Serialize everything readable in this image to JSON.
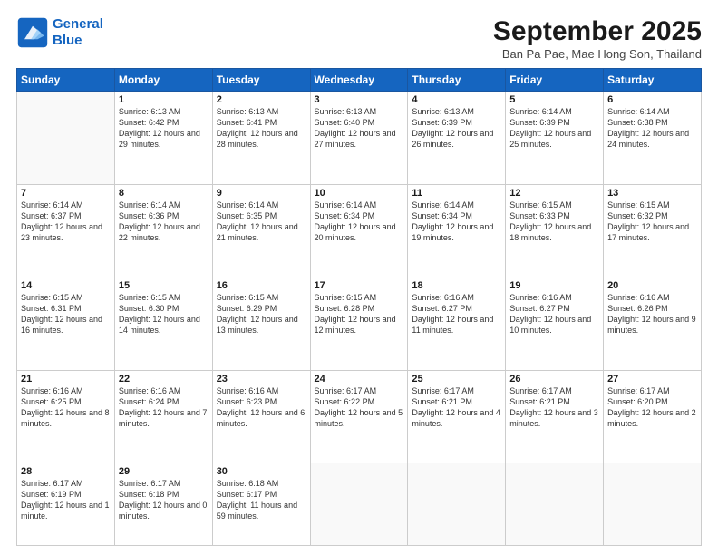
{
  "logo": {
    "line1": "General",
    "line2": "Blue"
  },
  "title": "September 2025",
  "subtitle": "Ban Pa Pae, Mae Hong Son, Thailand",
  "weekdays": [
    "Sunday",
    "Monday",
    "Tuesday",
    "Wednesday",
    "Thursday",
    "Friday",
    "Saturday"
  ],
  "weeks": [
    [
      {
        "day": "",
        "sunrise": "",
        "sunset": "",
        "daylight": ""
      },
      {
        "day": "1",
        "sunrise": "Sunrise: 6:13 AM",
        "sunset": "Sunset: 6:42 PM",
        "daylight": "Daylight: 12 hours and 29 minutes."
      },
      {
        "day": "2",
        "sunrise": "Sunrise: 6:13 AM",
        "sunset": "Sunset: 6:41 PM",
        "daylight": "Daylight: 12 hours and 28 minutes."
      },
      {
        "day": "3",
        "sunrise": "Sunrise: 6:13 AM",
        "sunset": "Sunset: 6:40 PM",
        "daylight": "Daylight: 12 hours and 27 minutes."
      },
      {
        "day": "4",
        "sunrise": "Sunrise: 6:13 AM",
        "sunset": "Sunset: 6:39 PM",
        "daylight": "Daylight: 12 hours and 26 minutes."
      },
      {
        "day": "5",
        "sunrise": "Sunrise: 6:14 AM",
        "sunset": "Sunset: 6:39 PM",
        "daylight": "Daylight: 12 hours and 25 minutes."
      },
      {
        "day": "6",
        "sunrise": "Sunrise: 6:14 AM",
        "sunset": "Sunset: 6:38 PM",
        "daylight": "Daylight: 12 hours and 24 minutes."
      }
    ],
    [
      {
        "day": "7",
        "sunrise": "Sunrise: 6:14 AM",
        "sunset": "Sunset: 6:37 PM",
        "daylight": "Daylight: 12 hours and 23 minutes."
      },
      {
        "day": "8",
        "sunrise": "Sunrise: 6:14 AM",
        "sunset": "Sunset: 6:36 PM",
        "daylight": "Daylight: 12 hours and 22 minutes."
      },
      {
        "day": "9",
        "sunrise": "Sunrise: 6:14 AM",
        "sunset": "Sunset: 6:35 PM",
        "daylight": "Daylight: 12 hours and 21 minutes."
      },
      {
        "day": "10",
        "sunrise": "Sunrise: 6:14 AM",
        "sunset": "Sunset: 6:34 PM",
        "daylight": "Daylight: 12 hours and 20 minutes."
      },
      {
        "day": "11",
        "sunrise": "Sunrise: 6:14 AM",
        "sunset": "Sunset: 6:34 PM",
        "daylight": "Daylight: 12 hours and 19 minutes."
      },
      {
        "day": "12",
        "sunrise": "Sunrise: 6:15 AM",
        "sunset": "Sunset: 6:33 PM",
        "daylight": "Daylight: 12 hours and 18 minutes."
      },
      {
        "day": "13",
        "sunrise": "Sunrise: 6:15 AM",
        "sunset": "Sunset: 6:32 PM",
        "daylight": "Daylight: 12 hours and 17 minutes."
      }
    ],
    [
      {
        "day": "14",
        "sunrise": "Sunrise: 6:15 AM",
        "sunset": "Sunset: 6:31 PM",
        "daylight": "Daylight: 12 hours and 16 minutes."
      },
      {
        "day": "15",
        "sunrise": "Sunrise: 6:15 AM",
        "sunset": "Sunset: 6:30 PM",
        "daylight": "Daylight: 12 hours and 14 minutes."
      },
      {
        "day": "16",
        "sunrise": "Sunrise: 6:15 AM",
        "sunset": "Sunset: 6:29 PM",
        "daylight": "Daylight: 12 hours and 13 minutes."
      },
      {
        "day": "17",
        "sunrise": "Sunrise: 6:15 AM",
        "sunset": "Sunset: 6:28 PM",
        "daylight": "Daylight: 12 hours and 12 minutes."
      },
      {
        "day": "18",
        "sunrise": "Sunrise: 6:16 AM",
        "sunset": "Sunset: 6:27 PM",
        "daylight": "Daylight: 12 hours and 11 minutes."
      },
      {
        "day": "19",
        "sunrise": "Sunrise: 6:16 AM",
        "sunset": "Sunset: 6:27 PM",
        "daylight": "Daylight: 12 hours and 10 minutes."
      },
      {
        "day": "20",
        "sunrise": "Sunrise: 6:16 AM",
        "sunset": "Sunset: 6:26 PM",
        "daylight": "Daylight: 12 hours and 9 minutes."
      }
    ],
    [
      {
        "day": "21",
        "sunrise": "Sunrise: 6:16 AM",
        "sunset": "Sunset: 6:25 PM",
        "daylight": "Daylight: 12 hours and 8 minutes."
      },
      {
        "day": "22",
        "sunrise": "Sunrise: 6:16 AM",
        "sunset": "Sunset: 6:24 PM",
        "daylight": "Daylight: 12 hours and 7 minutes."
      },
      {
        "day": "23",
        "sunrise": "Sunrise: 6:16 AM",
        "sunset": "Sunset: 6:23 PM",
        "daylight": "Daylight: 12 hours and 6 minutes."
      },
      {
        "day": "24",
        "sunrise": "Sunrise: 6:17 AM",
        "sunset": "Sunset: 6:22 PM",
        "daylight": "Daylight: 12 hours and 5 minutes."
      },
      {
        "day": "25",
        "sunrise": "Sunrise: 6:17 AM",
        "sunset": "Sunset: 6:21 PM",
        "daylight": "Daylight: 12 hours and 4 minutes."
      },
      {
        "day": "26",
        "sunrise": "Sunrise: 6:17 AM",
        "sunset": "Sunset: 6:21 PM",
        "daylight": "Daylight: 12 hours and 3 minutes."
      },
      {
        "day": "27",
        "sunrise": "Sunrise: 6:17 AM",
        "sunset": "Sunset: 6:20 PM",
        "daylight": "Daylight: 12 hours and 2 minutes."
      }
    ],
    [
      {
        "day": "28",
        "sunrise": "Sunrise: 6:17 AM",
        "sunset": "Sunset: 6:19 PM",
        "daylight": "Daylight: 12 hours and 1 minute."
      },
      {
        "day": "29",
        "sunrise": "Sunrise: 6:17 AM",
        "sunset": "Sunset: 6:18 PM",
        "daylight": "Daylight: 12 hours and 0 minutes."
      },
      {
        "day": "30",
        "sunrise": "Sunrise: 6:18 AM",
        "sunset": "Sunset: 6:17 PM",
        "daylight": "Daylight: 11 hours and 59 minutes."
      },
      {
        "day": "",
        "sunrise": "",
        "sunset": "",
        "daylight": ""
      },
      {
        "day": "",
        "sunrise": "",
        "sunset": "",
        "daylight": ""
      },
      {
        "day": "",
        "sunrise": "",
        "sunset": "",
        "daylight": ""
      },
      {
        "day": "",
        "sunrise": "",
        "sunset": "",
        "daylight": ""
      }
    ]
  ]
}
